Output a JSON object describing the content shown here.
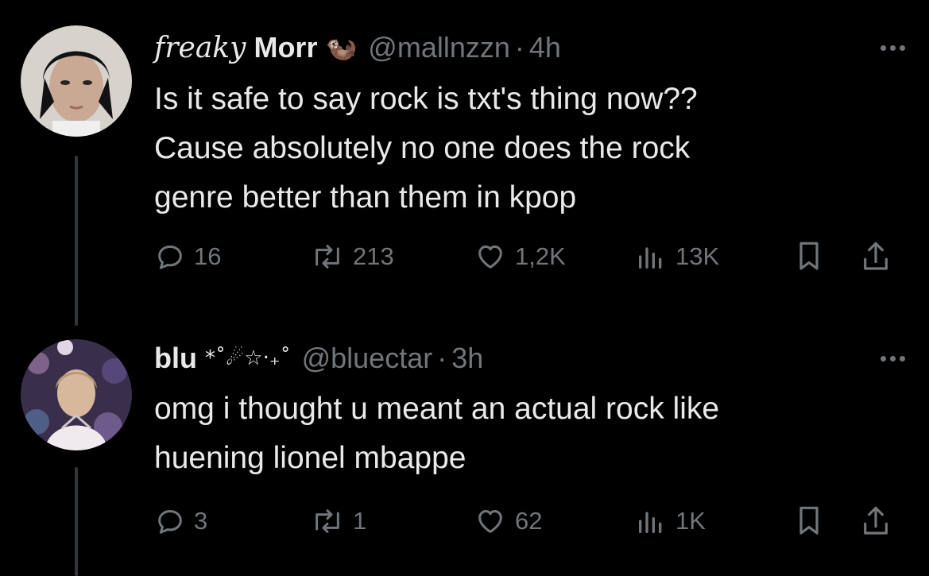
{
  "tweets": [
    {
      "display_name_styled": "freaky",
      "display_name": "Morr",
      "name_emoji": "🦦",
      "handle": "@mallnzzn",
      "separator": "·",
      "time": "4h",
      "text_lines": [
        "Is it safe to say rock is txt's thing now??",
        "Cause absolutely no one does the rock",
        "genre better than them in kpop"
      ],
      "replies": "16",
      "reposts": "213",
      "likes": "1,2K",
      "views": "13K"
    },
    {
      "display_name": "blu",
      "name_decoration": "*˚☄︎☆‧₊˚",
      "handle": "@bluectar",
      "separator": "·",
      "time": "3h",
      "text_lines": [
        "omg i thought u meant an actual rock like",
        "huening lionel mbappe"
      ],
      "replies": "3",
      "reposts": "1",
      "likes": "62",
      "views": "1K"
    }
  ],
  "icons": {
    "reply": "speech-bubble-icon",
    "repost": "repost-arrows-icon",
    "like": "heart-icon",
    "views": "bar-chart-icon",
    "bookmark": "bookmark-icon",
    "share": "share-upload-icon",
    "more": "more-dots-icon"
  },
  "colors": {
    "background": "#000000",
    "text_primary": "#e7e9ea",
    "text_secondary": "#71767b",
    "thread_line": "#333639"
  }
}
